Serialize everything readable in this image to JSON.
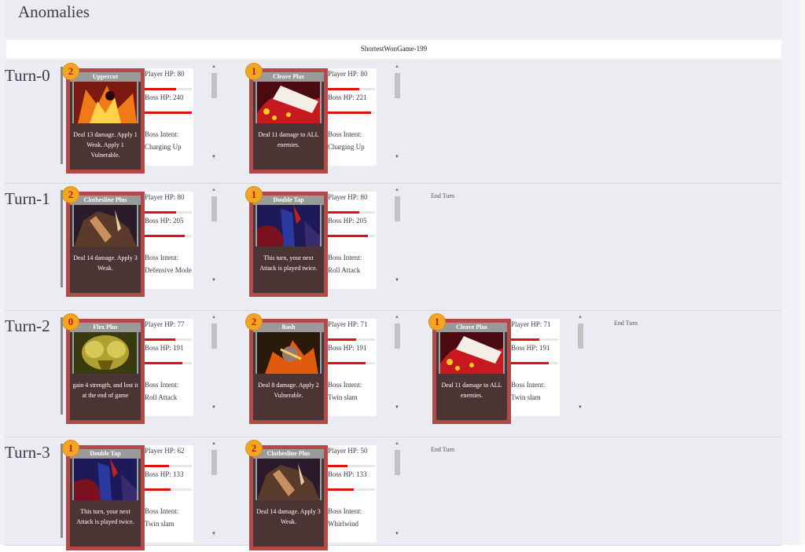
{
  "title": "Anomalies",
  "game_name": "ShortestWonGame-199",
  "icons": {
    "scroll_up": "arrow-up-icon",
    "scroll_down": "arrow-down-icon"
  },
  "colors": {
    "card_frame": "#b24a4a",
    "card_body": "#4a3434",
    "hp_bar": "#e01010",
    "cost_orb": "#f2a623"
  },
  "turns": [
    {
      "label": "Turn-0",
      "end_turn": "",
      "plays": [
        {
          "cost": "2",
          "card": "Uppercut",
          "desc": "Deal 13 damage. Apply 1 Weak. Apply 1 Vulnerable.",
          "player_hp": "Player HP: 80",
          "player_frac": 0.8,
          "boss_hp": "Boss HP: 240",
          "boss_frac": 1.0,
          "intent_label": "Boss Intent:",
          "intent": "Charging Up"
        },
        {
          "cost": "1",
          "card": "Cleave Plus",
          "desc": "Deal 11 damage to ALL enemies.",
          "player_hp": "Player HP: 80",
          "player_frac": 0.8,
          "boss_hp": "Boss HP: 221",
          "boss_frac": 0.92,
          "intent_label": "Boss Intent:",
          "intent": "Charging Up"
        }
      ]
    },
    {
      "label": "Turn-1",
      "end_turn": "End Turn",
      "plays": [
        {
          "cost": "2",
          "card": "Clothesline Plus",
          "desc": "Deal 14 damage. Apply 3 Weak.",
          "player_hp": "Player HP: 80",
          "player_frac": 0.8,
          "boss_hp": "Boss HP: 205",
          "boss_frac": 0.85,
          "intent_label": "Boss Intent:",
          "intent": "Defensive Mode"
        },
        {
          "cost": "1",
          "card": "Double Tap",
          "desc": "This turn, your next Attack is played twice.",
          "player_hp": "Player HP: 80",
          "player_frac": 0.8,
          "boss_hp": "Boss HP: 205",
          "boss_frac": 0.85,
          "intent_label": "Boss Intent:",
          "intent": "Roll Attack"
        }
      ]
    },
    {
      "label": "Turn-2",
      "end_turn": "End Turn",
      "plays": [
        {
          "cost": "0",
          "card": "Flex Plus",
          "desc": "gain 4 strength, and lost it at the end of game",
          "player_hp": "Player HP: 77",
          "player_frac": 0.77,
          "boss_hp": "Boss HP: 191",
          "boss_frac": 0.8,
          "intent_label": "Boss Intent:",
          "intent": "Roll Attack"
        },
        {
          "cost": "2",
          "card": "Bash",
          "desc": "Deal 8 damage. Apply 2 Vulnerable.",
          "player_hp": "Player HP: 71",
          "player_frac": 0.71,
          "boss_hp": "Boss HP: 191",
          "boss_frac": 0.8,
          "intent_label": "Boss Intent:",
          "intent": "Twin slam"
        },
        {
          "cost": "1",
          "card": "Cleave Plus",
          "desc": "Deal 11 damage to ALL enemies.",
          "player_hp": "Player HP: 71",
          "player_frac": 0.71,
          "boss_hp": "Boss HP: 191",
          "boss_frac": 0.8,
          "intent_label": "Boss Intent:",
          "intent": "Twin slam"
        }
      ]
    },
    {
      "label": "Turn-3",
      "end_turn": "End Turn",
      "plays": [
        {
          "cost": "1",
          "card": "Double Tap",
          "desc": "This turn, your next Attack is played twice.",
          "player_hp": "Player HP: 62",
          "player_frac": 0.62,
          "boss_hp": "Boss HP: 133",
          "boss_frac": 0.55,
          "intent_label": "Boss Intent:",
          "intent": "Twin slam"
        },
        {
          "cost": "2",
          "card": "Clothesline Plus",
          "desc": "Deal 14 damage. Apply 3 Weak.",
          "player_hp": "Player HP: 50",
          "player_frac": 0.5,
          "boss_hp": "Boss HP: 133",
          "boss_frac": 0.55,
          "intent_label": "Boss Intent:",
          "intent": "Whirlwind"
        }
      ]
    }
  ]
}
